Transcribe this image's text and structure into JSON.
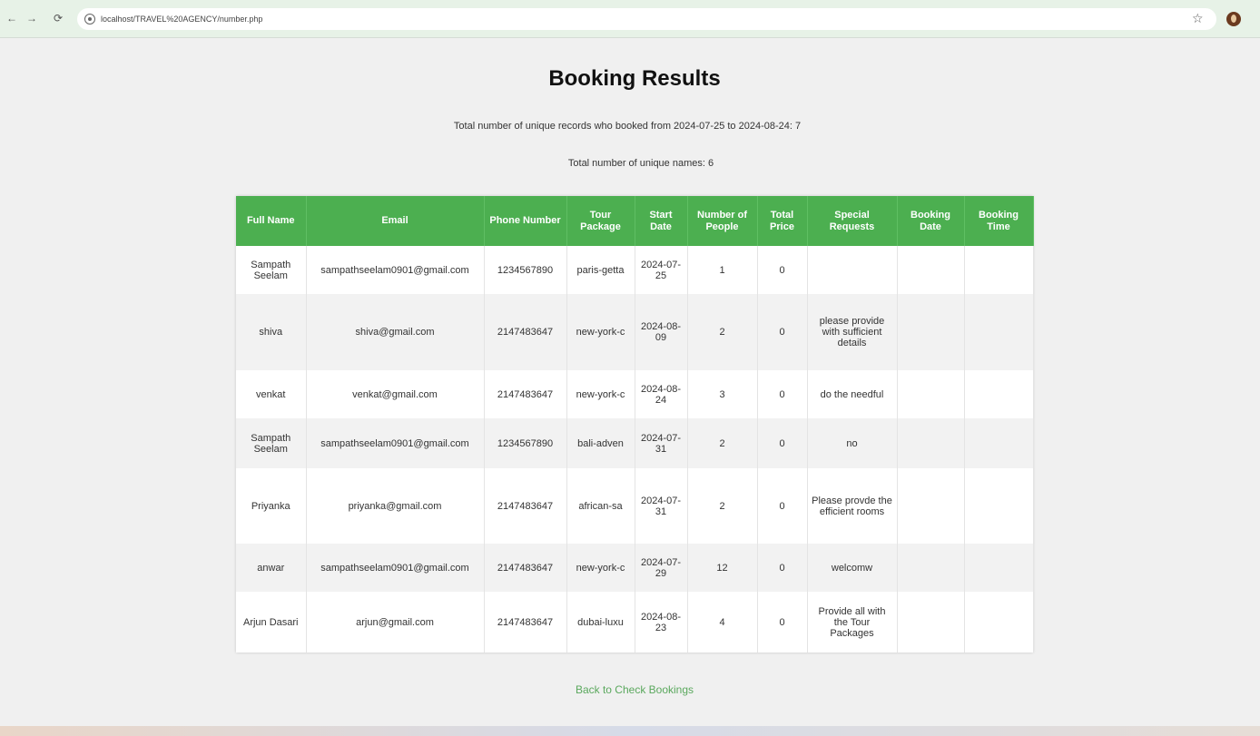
{
  "browser": {
    "url": "localhost/TRAVEL%20AGENCY/number.php",
    "back_icon": "←",
    "forward_icon": "→",
    "reload_icon": "⟳",
    "star_icon": "☆"
  },
  "page": {
    "title": "Booking Results",
    "summary_records": "Total number of unique records who booked from 2024-07-25 to 2024-08-24: 7",
    "summary_names": "Total number of unique names: 6",
    "back_link": "Back to Check Bookings"
  },
  "colors": {
    "header_green": "#4caf50",
    "link_green": "#5aa85d"
  },
  "table": {
    "headers": [
      "Full Name",
      "Email",
      "Phone Number",
      "Tour Package",
      "Start Date",
      "Number of People",
      "Total Price",
      "Special Requests",
      "Booking Date",
      "Booking Time"
    ],
    "rows": [
      [
        "Sampath Seelam",
        "sampathseelam0901@gmail.com",
        "1234567890",
        "paris-getta",
        "2024-07-25",
        "1",
        "0",
        "",
        "",
        ""
      ],
      [
        "shiva",
        "shiva@gmail.com",
        "2147483647",
        "new-york-c",
        "2024-08-09",
        "2",
        "0",
        "please provide with sufficient details",
        "",
        ""
      ],
      [
        "venkat",
        "venkat@gmail.com",
        "2147483647",
        "new-york-c",
        "2024-08-24",
        "3",
        "0",
        "do the needful",
        "",
        ""
      ],
      [
        "Sampath Seelam",
        "sampathseelam0901@gmail.com",
        "1234567890",
        "bali-adven",
        "2024-07-31",
        "2",
        "0",
        "no",
        "",
        ""
      ],
      [
        "Priyanka",
        "priyanka@gmail.com",
        "2147483647",
        "african-sa",
        "2024-07-31",
        "2",
        "0",
        "Please provde the efficient rooms",
        "",
        ""
      ],
      [
        "anwar",
        "sampathseelam0901@gmail.com",
        "2147483647",
        "new-york-c",
        "2024-07-29",
        "12",
        "0",
        "welcomw",
        "",
        ""
      ],
      [
        "Arjun Dasari",
        "arjun@gmail.com",
        "2147483647",
        "dubai-luxu",
        "2024-08-23",
        "4",
        "0",
        "Provide all with the Tour Packages",
        "",
        ""
      ]
    ]
  }
}
